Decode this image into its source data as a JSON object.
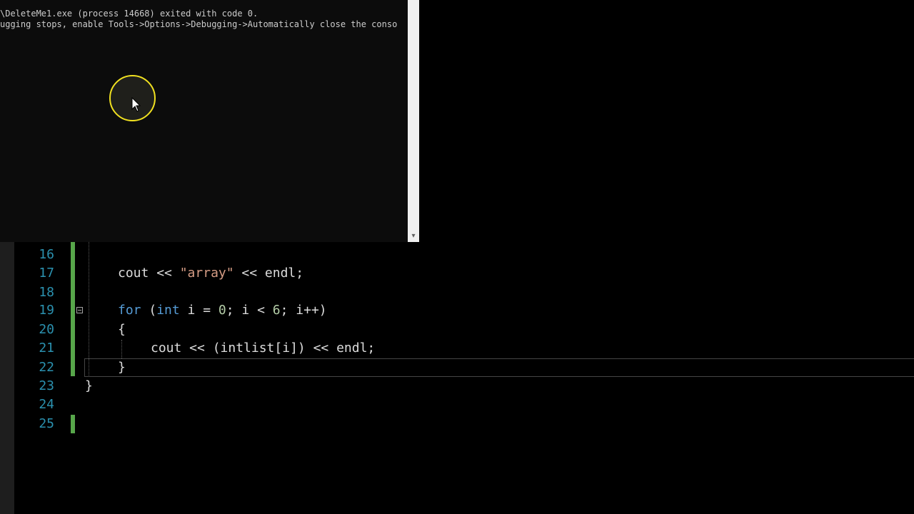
{
  "console": {
    "lines": [
      "\\DeleteMe1.exe (process 14668) exited with code 0.",
      "ugging stops, enable Tools->Options->Debugging->Automatically close the conso"
    ]
  },
  "editor": {
    "line_numbers": [
      "16",
      "17",
      "18",
      "19",
      "20",
      "21",
      "22",
      "23",
      "24",
      "25"
    ],
    "code": {
      "l17_ident": "cout",
      "l17_op1": " << ",
      "l17_str": "\"array\"",
      "l17_op2": " << endl;",
      "l19_for": "for",
      "l19_paren": " (",
      "l19_int": "int",
      "l19_i_eq": " i = ",
      "l19_zero": "0",
      "l19_cond": "; i < ",
      "l19_six": "6",
      "l19_inc": "; i++)",
      "l20_brace": "{",
      "l21_code": "cout << (intlist[i]) << endl;",
      "l22_brace": "}",
      "l23_brace": "}"
    }
  },
  "colors": {
    "keyword": "#569cd6",
    "string": "#d69d85",
    "number": "#b5cea8",
    "line_number": "#2b91af",
    "change_marker": "#57a64a",
    "cursor_ring": "#f0e020"
  },
  "icons": {
    "scroll_down": "▾"
  }
}
